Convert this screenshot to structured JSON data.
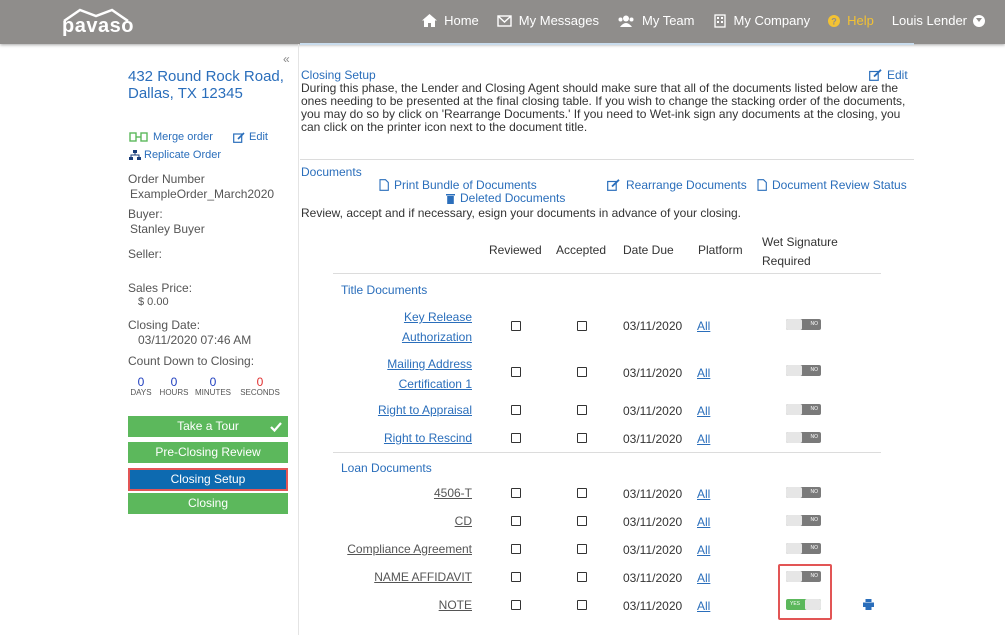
{
  "nav": {
    "logo": "pavaso",
    "home": "Home",
    "messages": "My Messages",
    "team": "My Team",
    "company": "My Company",
    "help": "Help",
    "user": "Louis Lender"
  },
  "sidebar": {
    "collapse": "«",
    "address": "432 Round Rock Road, Dallas, TX 12345",
    "merge_order": "Merge order",
    "edit": "Edit",
    "replicate_order": "Replicate Order",
    "order_number_label": "Order Number",
    "order_number": "ExampleOrder_March2020",
    "buyer_label": "Buyer:",
    "buyer": "Stanley Buyer",
    "seller_label": "Seller:",
    "sales_price_label": "Sales Price:",
    "sales_price": "$ 0.00",
    "closing_date_label": "Closing Date:",
    "closing_date": "03/11/2020 07:46 AM",
    "countdown_label": "Count Down to Closing:",
    "countdown": [
      {
        "value": "0",
        "unit": "DAYS",
        "color": "#1f3fbf"
      },
      {
        "value": "0",
        "unit": "HOURS",
        "color": "#1f3fbf"
      },
      {
        "value": "0",
        "unit": "MINUTES",
        "color": "#1f3fbf"
      },
      {
        "value": "0",
        "unit": "SECONDS",
        "color": "#e03030"
      }
    ],
    "steps": [
      "Take a Tour",
      "Pre-Closing Review",
      "Closing Setup",
      "Closing"
    ]
  },
  "main": {
    "section_title": "Closing Setup",
    "edit": "Edit",
    "description": "During this phase, the Lender and Closing Agent should make sure that all of the documents listed below are the ones needing to be presented at the final closing table. If you wish to change the stacking order of the documents, you may do so by click on 'Rearrange Documents.' If you need to Wet-ink sign any documents at the closing, you can click on the printer icon next to the document title.",
    "documents_title": "Documents",
    "print_bundle": "Print Bundle of Documents",
    "rearrange": "Rearrange Documents",
    "review_status": "Document Review Status",
    "deleted": "Deleted Documents",
    "review_text": "Review, accept and if necessary, esign your documents in advance of your closing.",
    "headers": {
      "reviewed": "Reviewed",
      "accepted": "Accepted",
      "date_due": "Date Due",
      "platform": "Platform",
      "wet_sig_1": "Wet Signature",
      "wet_sig_2": "Required"
    },
    "title_documents": "Title Documents",
    "loan_documents": "Loan Documents",
    "toggle_no": "NO",
    "toggle_yes": "YES",
    "title_docs": [
      {
        "name1": "Key Release",
        "name2": "Authorization",
        "date": "03/11/2020",
        "platform": "All",
        "wet": "NO"
      },
      {
        "name1": "Mailing Address",
        "name2": "Certification 1",
        "date": "03/11/2020",
        "platform": "All",
        "wet": "NO"
      },
      {
        "name1": "Right to Appraisal",
        "name2": "",
        "date": "03/11/2020",
        "platform": "All",
        "wet": "NO"
      },
      {
        "name1": "Right to Rescind",
        "name2": "",
        "date": "03/11/2020",
        "platform": "All",
        "wet": "NO"
      }
    ],
    "loan_docs": [
      {
        "name": "4506-T",
        "date": "03/11/2020",
        "platform": "All",
        "wet": "NO"
      },
      {
        "name": "CD",
        "date": "03/11/2020",
        "platform": "All",
        "wet": "NO"
      },
      {
        "name": "Compliance Agreement",
        "date": "03/11/2020",
        "platform": "All",
        "wet": "NO"
      },
      {
        "name": "NAME AFFIDAVIT",
        "date": "03/11/2020",
        "platform": "All",
        "wet": "NO"
      },
      {
        "name": "NOTE",
        "date": "03/11/2020",
        "platform": "All",
        "wet": "YES"
      }
    ]
  }
}
